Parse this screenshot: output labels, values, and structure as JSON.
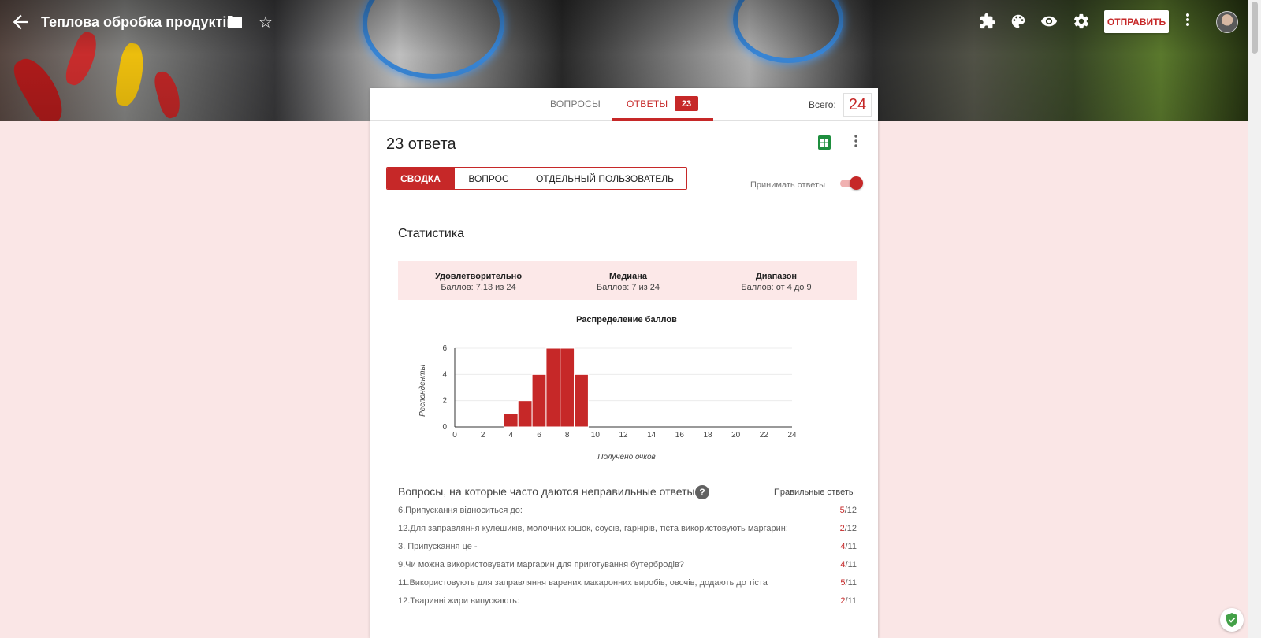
{
  "header": {
    "title": "Теплова обробка продуктів",
    "send_label": "ОТПРАВИТЬ"
  },
  "tabs": {
    "questions_label": "ВОПРОСЫ",
    "answers_label": "ОТВЕТЫ",
    "answers_badge": "23",
    "total_label": "Всего:",
    "total_value": "24"
  },
  "responses": {
    "count_title": "23 ответа",
    "views": [
      "СВОДКА",
      "ВОПРОС",
      "ОТДЕЛЬНЫЙ ПОЛЬЗОВАТЕЛЬ"
    ],
    "active_view": "СВОДКА",
    "accept_label": "Принимать ответы",
    "accept_on": true
  },
  "stats": {
    "title": "Статистика",
    "items": [
      {
        "label": "Удовлетворительно",
        "value": "Баллов: 7,13 из 24"
      },
      {
        "label": "Медиана",
        "value": "Баллов: 7 из 24"
      },
      {
        "label": "Диапазон",
        "value": "Баллов: от 4 до 9"
      }
    ]
  },
  "chart_data": {
    "type": "bar",
    "title": "Распределение баллов",
    "xlabel": "Получено очков",
    "ylabel": "Респонденты",
    "x": [
      4,
      5,
      6,
      7,
      8,
      9
    ],
    "values": [
      1,
      2,
      4,
      6,
      6,
      4
    ],
    "xlim": [
      0,
      24
    ],
    "ylim": [
      0,
      6
    ],
    "xticks": [
      0,
      2,
      4,
      6,
      8,
      10,
      12,
      14,
      16,
      18,
      20,
      22,
      24
    ],
    "yticks": [
      0,
      2,
      4,
      6
    ],
    "grid": true,
    "bar_color": "#c62828"
  },
  "wrong_answers": {
    "title": "Вопросы, на которые часто даются неправильные ответы",
    "correct_label": "Правильные ответы",
    "items": [
      {
        "question": "6.Припускання відноситься до:",
        "correct": "5",
        "total": "/12"
      },
      {
        "question": "12.Для заправляння кулешиків, молочних юшок, соусів, гарнірів, тіста використовують маргарин:",
        "correct": "2",
        "total": "/12"
      },
      {
        "question": "3. Припускання це -",
        "correct": "4",
        "total": "/11"
      },
      {
        "question": "9.Чи можна використовувати маргарин для приготування бутербродів?",
        "correct": "4",
        "total": "/11"
      },
      {
        "question": "11.Використовують для заправляння варених макаронних виробів, овочів, додають до тіста",
        "correct": "5",
        "total": "/11"
      },
      {
        "question": "12.Тваринні жири випускають:",
        "correct": "2",
        "total": "/11"
      }
    ]
  },
  "colors": {
    "accent": "#c62828",
    "page_bg": "#fae6e6"
  }
}
